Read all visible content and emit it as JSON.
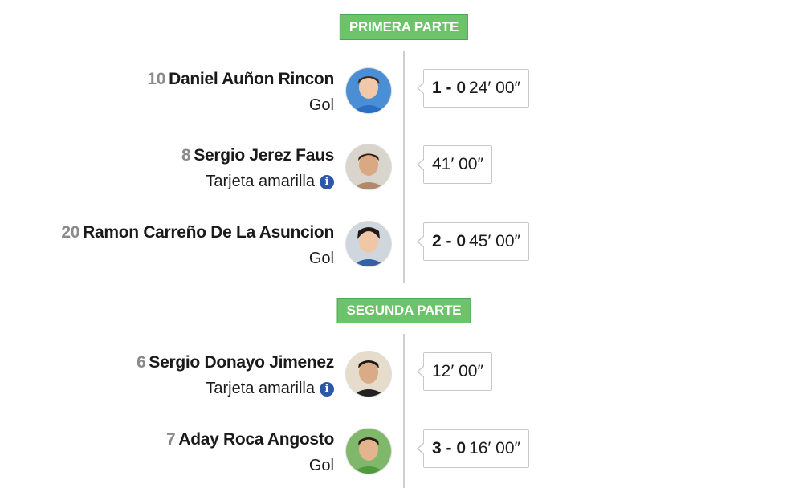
{
  "halves": {
    "first": {
      "label": "PRIMERA PARTE"
    },
    "second": {
      "label": "SEGUNDA PARTE"
    }
  },
  "events": [
    {
      "number": "10",
      "name": "Daniel Auñon Rincon",
      "type": "Gol",
      "score": "1 - 0",
      "time": "24′ 00″",
      "has_info": false
    },
    {
      "number": "8",
      "name": "Sergio Jerez Faus",
      "type": "Tarjeta amarilla",
      "score": "",
      "time": "41′ 00″",
      "has_info": true
    },
    {
      "number": "20",
      "name": "Ramon Carreño De La Asuncion",
      "type": "Gol",
      "score": "2 - 0",
      "time": "45′ 00″",
      "has_info": false
    },
    {
      "number": "6",
      "name": "Sergio Donayo Jimenez",
      "type": "Tarjeta amarilla",
      "score": "",
      "time": "12′ 00″",
      "has_info": true
    },
    {
      "number": "7",
      "name": "Aday Roca Angosto",
      "type": "Gol",
      "score": "3 - 0",
      "time": "16′ 00″",
      "has_info": false
    }
  ],
  "colors": {
    "badge": "#6cc36a",
    "timeline": "#cfcfcf",
    "info_icon": "#2e56a8"
  },
  "info_icon_glyph": "i",
  "avatar_icon": "player-photo"
}
